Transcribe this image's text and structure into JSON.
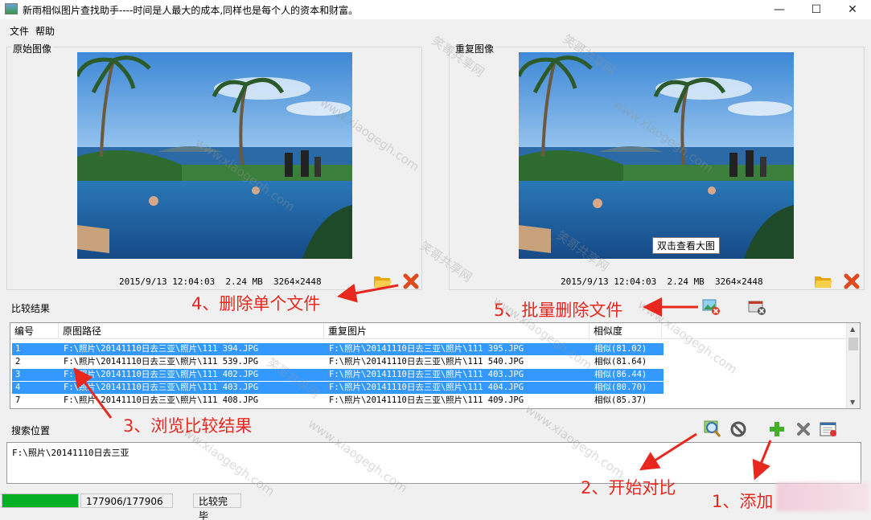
{
  "window": {
    "title": "新雨相似图片查找助手----时间是人最大的成本,同样也是每个人的资本和财富。",
    "minimize": "—",
    "maximize": "☐",
    "close": "✕"
  },
  "menu": {
    "file": "文件",
    "help": "帮助"
  },
  "original": {
    "label": "原始图像",
    "meta": "2015/9/13 12:04:03  2.24 MB  3264×2448"
  },
  "duplicate": {
    "label": "重复图像",
    "meta": "2015/9/13 12:04:03  2.24 MB  3264×2448",
    "tooltip": "双击查看大图"
  },
  "results": {
    "label": "比较结果",
    "columns": [
      "编号",
      "原图路径",
      "重复图片",
      "相似度"
    ],
    "rows": [
      {
        "id": "1",
        "orig": "F:\\照片\\20141110日去三亚\\照片\\111 394.JPG",
        "dup": "F:\\照片\\20141110日去三亚\\照片\\111 395.JPG",
        "sim": "相似(81.02)",
        "selected": true
      },
      {
        "id": "2",
        "orig": "F:\\照片\\20141110日去三亚\\照片\\111 539.JPG",
        "dup": "F:\\照片\\20141110日去三亚\\照片\\111 540.JPG",
        "sim": "相似(81.64)",
        "selected": false
      },
      {
        "id": "3",
        "orig": "F:\\照片\\20141110日去三亚\\照片\\111 402.JPG",
        "dup": "F:\\照片\\20141110日去三亚\\照片\\111 403.JPG",
        "sim": "相似(86.44)",
        "selected": true
      },
      {
        "id": "4",
        "orig": "F:\\照片\\20141110日去三亚\\照片\\111 403.JPG",
        "dup": "F:\\照片\\20141110日去三亚\\照片\\111 404.JPG",
        "sim": "相似(80.70)",
        "selected": true
      },
      {
        "id": "7",
        "orig": "F:\\照片\\20141110日去三亚\\照片\\111 408.JPG",
        "dup": "F:\\照片\\20141110日去三亚\\照片\\111 409.JPG",
        "sim": "相似(85.37)",
        "selected": false
      }
    ]
  },
  "search": {
    "label": "搜索位置",
    "path": "F:\\照片\\20141110日去三亚"
  },
  "status": {
    "progress": 1.0,
    "count": "177906/177906",
    "state": "比较完毕"
  },
  "annotations": {
    "step1": "1、添加",
    "step2": "2、开始对比",
    "step3": "3、浏览比较结果",
    "step4": "4、删除单个文件",
    "step5": "5、批量删除文件"
  },
  "watermark": {
    "name": "笑哥共享网",
    "url": "www.xiaogegh.com"
  },
  "colors": {
    "selection": "#3399ff",
    "annotation": "#e8281e",
    "progress": "#06b025"
  }
}
